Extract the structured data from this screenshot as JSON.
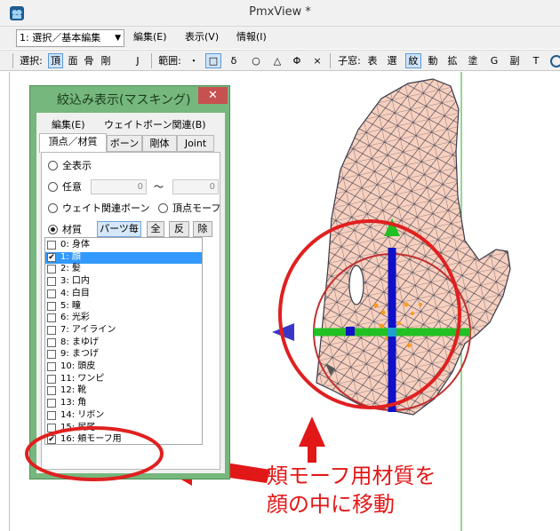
{
  "window": {
    "title": "PmxView *"
  },
  "menubar": {
    "mode_select": "1: 選択／基本編集",
    "items": [
      {
        "label": "編集(E)"
      },
      {
        "label": "表示(V)"
      },
      {
        "label": "情報(I)"
      }
    ]
  },
  "toolbar": {
    "select_label": "選択:",
    "select_items": [
      "頂",
      "面",
      "骨",
      "剛",
      "J"
    ],
    "range_label": "範囲:",
    "range_items": [
      "・",
      "□",
      "δ",
      "○",
      "△",
      "Φ",
      "×"
    ],
    "child_label": "子窓:",
    "child_items": [
      "表",
      "選",
      "紋",
      "動",
      "拡",
      "塗",
      "G",
      "副",
      "T"
    ]
  },
  "dialog": {
    "title": "絞込み表示(マスキング)",
    "close": "✕",
    "menu": [
      "編集(E)",
      "ウェイトボーン関連(B)"
    ],
    "tabs": [
      "頂点／材質",
      "ボーン",
      "剛体",
      "Joint"
    ],
    "options": {
      "all": "全表示",
      "range": "任意",
      "range_from": "0",
      "range_to": "0",
      "tilde": "〜",
      "weight_bone": "ウェイト関連ボーン",
      "vertex_morph": "頂点モーフ",
      "material": "材質",
      "per_part_button": "パーツ毎",
      "all_button": "全",
      "invert_button": "反",
      "remove_button": "除"
    },
    "materials": [
      {
        "label": "0: 身体",
        "checked": false
      },
      {
        "label": "1: 顔",
        "checked": true,
        "selected": true
      },
      {
        "label": "2: 髪",
        "checked": false
      },
      {
        "label": "3: 口内",
        "checked": false
      },
      {
        "label": "4: 白目",
        "checked": false
      },
      {
        "label": "5: 瞳",
        "checked": false
      },
      {
        "label": "6: 光彩",
        "checked": false
      },
      {
        "label": "7: アイライン",
        "checked": false
      },
      {
        "label": "8: まゆげ",
        "checked": false
      },
      {
        "label": "9: まつげ",
        "checked": false
      },
      {
        "label": "10: 頭皮",
        "checked": false
      },
      {
        "label": "11: ワンピ",
        "checked": false
      },
      {
        "label": "12: 靴",
        "checked": false
      },
      {
        "label": "13: 角",
        "checked": false
      },
      {
        "label": "14: リボン",
        "checked": false
      },
      {
        "label": "15: 尻尾",
        "checked": false
      },
      {
        "label": "16: 頬モーフ用",
        "checked": true
      }
    ]
  },
  "annotation": {
    "line1": "頬モーフ用材質を",
    "line2": "顔の中に移動"
  },
  "colors": {
    "dialog_frame": "#75b77c",
    "close_button": "#c75050",
    "selection": "#3399ff",
    "annotation": "#e21818",
    "mesh_fill": "#f7d0bf",
    "gizmo_green": "#22c022",
    "gizmo_blue": "#1010c8"
  }
}
